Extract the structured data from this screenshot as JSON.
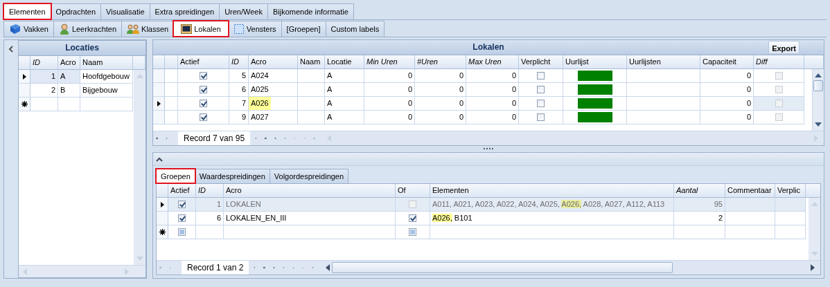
{
  "main_tabs": [
    {
      "label": "Elementen",
      "selected": true
    },
    {
      "label": "Opdrachten",
      "selected": false
    },
    {
      "label": "Visualisatie",
      "selected": false
    },
    {
      "label": "Extra spreidingen",
      "selected": false
    },
    {
      "label": "Uren/Week",
      "selected": false
    },
    {
      "label": "Bijkomende informatie",
      "selected": false
    }
  ],
  "element_tabs": [
    {
      "label": "Vakken",
      "selected": false
    },
    {
      "label": "Leerkrachten",
      "selected": false
    },
    {
      "label": "Klassen",
      "selected": false
    },
    {
      "label": "Lokalen",
      "selected": true
    },
    {
      "label": "Vensters",
      "selected": false
    },
    {
      "label": "[Groepen]",
      "selected": false
    },
    {
      "label": "Custom labels",
      "selected": false
    }
  ],
  "locaties": {
    "title": "Locaties",
    "columns": [
      {
        "label": "ID",
        "italic": true
      },
      {
        "label": "Acro",
        "italic": false
      },
      {
        "label": "Naam",
        "italic": false
      }
    ],
    "rows": [
      {
        "current": true,
        "id": "1",
        "acro": "A",
        "naam": "Hoofdgebouw"
      },
      {
        "current": false,
        "id": "2",
        "acro": "B",
        "naam": "Bijgebouw"
      }
    ]
  },
  "lokalen": {
    "title": "Lokalen",
    "export_button": "Export",
    "columns": [
      {
        "label": "Actief",
        "italic": false
      },
      {
        "label": "ID",
        "italic": true
      },
      {
        "label": "Acro",
        "italic": false
      },
      {
        "label": "Naam",
        "italic": false
      },
      {
        "label": "Locatie",
        "italic": false
      },
      {
        "label": "Min Uren",
        "italic": true
      },
      {
        "label": "#Uren",
        "italic": true
      },
      {
        "label": "Max Uren",
        "italic": true
      },
      {
        "label": "Verplicht",
        "italic": false
      },
      {
        "label": "Uurlijst",
        "italic": false
      },
      {
        "label": "Uurlijsten",
        "italic": false
      },
      {
        "label": "Capaciteit",
        "italic": false
      },
      {
        "label": "Diff",
        "italic": true
      }
    ],
    "rows": [
      {
        "current": false,
        "actief": true,
        "id": "5",
        "acro": "A024",
        "acro_highlighted": false,
        "locatie": "A",
        "min_uren": "0",
        "uren": "0",
        "max_uren": "0",
        "verplicht": false,
        "capaciteit": "0",
        "diff": {
          "checked": false,
          "disabled": true
        }
      },
      {
        "current": false,
        "actief": true,
        "id": "6",
        "acro": "A025",
        "acro_highlighted": false,
        "locatie": "A",
        "min_uren": "0",
        "uren": "0",
        "max_uren": "0",
        "verplicht": false,
        "capaciteit": "0",
        "diff": {
          "checked": false,
          "disabled": true
        }
      },
      {
        "current": true,
        "actief": true,
        "id": "7",
        "acro": "A026",
        "acro_highlighted": true,
        "locatie": "A",
        "min_uren": "0",
        "uren": "0",
        "max_uren": "0",
        "verplicht": false,
        "capaciteit": "0",
        "diff": {
          "checked": false,
          "disabled": true
        }
      },
      {
        "current": false,
        "actief": true,
        "id": "9",
        "acro": "A027",
        "acro_highlighted": false,
        "locatie": "A",
        "min_uren": "0",
        "uren": "0",
        "max_uren": "0",
        "verplicht": false,
        "capaciteit": "0",
        "diff": {
          "checked": false,
          "disabled": true
        }
      }
    ],
    "record": "Record 7 van 95"
  },
  "detail": {
    "tabs": [
      {
        "label": "Groepen",
        "selected": true
      },
      {
        "label": "Waardespreidingen",
        "selected": false
      },
      {
        "label": "Volgordespreidingen",
        "selected": false
      }
    ],
    "columns": [
      {
        "label": "Actief",
        "italic": false
      },
      {
        "label": "ID",
        "italic": true
      },
      {
        "label": "Acro",
        "italic": false
      },
      {
        "label": "Of",
        "italic": false
      },
      {
        "label": "Elementen",
        "italic": false
      },
      {
        "label": "Aantal",
        "italic": true
      },
      {
        "label": "Commentaar",
        "italic": false
      },
      {
        "label": "Verplic",
        "italic": false
      }
    ],
    "rows": [
      {
        "current": true,
        "greyed": true,
        "actief": true,
        "id": "1",
        "acro": "LOKALEN",
        "of": {
          "checked": false,
          "disabled": true
        },
        "elementen": [
          {
            "text": "A011, A021, A023, A022, A024, A025, ",
            "highlighted": false
          },
          {
            "text": "A026,",
            "highlighted": true
          },
          {
            "text": " A028, A027, A112, A113",
            "highlighted": false
          }
        ],
        "aantal": "95"
      },
      {
        "current": false,
        "greyed": false,
        "actief": true,
        "id": "6",
        "acro": "LOKALEN_EN_III",
        "of": {
          "checked": true,
          "disabled": false
        },
        "elementen": [
          {
            "text": "A026,",
            "highlighted": true
          },
          {
            "text": " B101",
            "highlighted": false
          }
        ],
        "aantal": "2"
      }
    ],
    "new_row": {
      "actief_indeterminate": true,
      "of_indeterminate": true
    },
    "record": "Record 1 van 2"
  }
}
